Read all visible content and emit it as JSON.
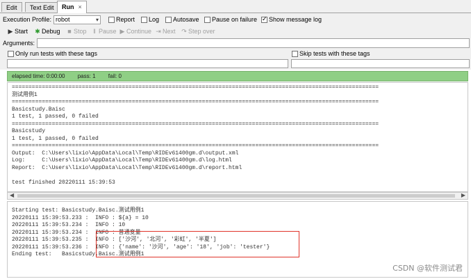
{
  "tabs": [
    {
      "label": "Edit"
    },
    {
      "label": "Text Edit"
    },
    {
      "label": "Run",
      "close": "×"
    }
  ],
  "toolbar1": {
    "execution_profile_label": "Execution Profile:",
    "profile_value": "robot",
    "report_label": "Report",
    "log_label": "Log",
    "autosave_label": "Autosave",
    "pause_on_failure_label": "Pause on failure",
    "show_message_log_label": "Show message log"
  },
  "toolbar2": {
    "start": "Start",
    "debug": "Debug",
    "stop": "Stop",
    "pause": "Pause",
    "continue": "Continue",
    "next": "Next",
    "step_over": "Step over"
  },
  "arguments_label": "Arguments:",
  "tags": {
    "only_run": "Only run tests with these tags",
    "skip": "Skip tests with these tags"
  },
  "status": {
    "elapsed": "elapsed time: 0:00:00",
    "pass": "pass: 1",
    "fail": "fail: 0"
  },
  "console_lines": [
    "==============================================================================================================",
    "测试用例1",
    "==============================================================================================================",
    "Basicstudy.Baisc",
    "1 test, 1 passed, 0 failed",
    "==============================================================================================================",
    "Basicstudy",
    "1 test, 1 passed, 0 failed",
    "==============================================================================================================",
    "Output:  C:\\Users\\lixio\\AppData\\Local\\Temp\\RIDEv61400gm.d\\output.xml",
    "Log:     C:\\Users\\lixio\\AppData\\Local\\Temp\\RIDEv61400gm.d\\log.html",
    "Report:  C:\\Users\\lixio\\AppData\\Local\\Temp\\RIDEv61400gm.d\\report.html",
    "",
    "test finished 20220111 15:39:53"
  ],
  "message_log_lines": [
    "Starting test: Basicstudy.Baisc.测试用例1",
    "20220111 15:39:53.233 :  INFO : ${a} = 10",
    "20220111 15:39:53.234 :  INFO : 10",
    "20220111 15:39:53.234 :  INFO : 普通变量",
    "20220111 15:39:53.235 :  INFO : ['沙河', '北河', '彩虹', '半夏']",
    "20220111 15:39:53.236 :  INFO : {'name': '沙河', 'age': '18', 'job': 'tester'}",
    "Ending test:   Basicstudy.Baisc.测试用例1"
  ],
  "watermark": "CSDN @软件测试君",
  "colors": {
    "status_bg": "#8fcf85",
    "highlight_border": "#e0342a"
  }
}
